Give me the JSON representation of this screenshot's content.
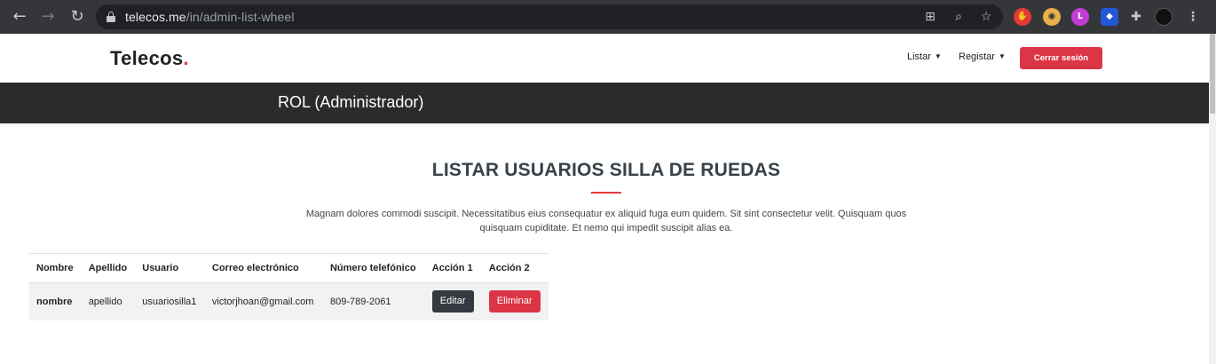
{
  "browser": {
    "url_host": "telecos.me",
    "url_path": "/in/admin-list-wheel"
  },
  "header": {
    "logo_text": "Telecos",
    "logo_dot": ".",
    "menu": [
      {
        "label": "Listar"
      },
      {
        "label": "Registar"
      }
    ],
    "logout_label": "Cerrar sesión"
  },
  "role_band": {
    "text": "ROL (Administrador)"
  },
  "section": {
    "title": "LISTAR USUARIOS SILLA DE RUEDAS",
    "description": "Magnam dolores commodi suscipit. Necessitatibus eius consequatur ex aliquid fuga eum quidem. Sit sint consectetur velit. Quisquam quos quisquam cupiditate. Et nemo qui impedit suscipit alias ea."
  },
  "table": {
    "headers": [
      "Nombre",
      "Apellido",
      "Usuario",
      "Correo electrónico",
      "Número telefónico",
      "Acción 1",
      "Acción 2"
    ],
    "rows": [
      {
        "nombre": "nombre",
        "apellido": "apellido",
        "usuario": "usuariosilla1",
        "correo": "victorjhoan@gmail.com",
        "telefono": "809-789-2061",
        "accion1": "Editar",
        "accion2": "Eliminar"
      }
    ]
  },
  "colors": {
    "accent": "#dc3545",
    "dark_band": "#2b2b2b",
    "button_dark": "#343a40"
  }
}
